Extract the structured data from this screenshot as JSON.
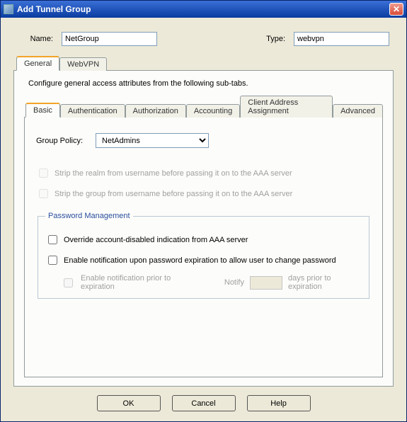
{
  "window": {
    "title": "Add Tunnel Group"
  },
  "form": {
    "name_label": "Name:",
    "name_value": "NetGroup",
    "type_label": "Type:",
    "type_value": "webvpn"
  },
  "top_tabs": {
    "general": "General",
    "webvpn": "WebVPN"
  },
  "prompt": "Configure general access attributes from the following sub-tabs.",
  "sub_tabs": {
    "basic": "Basic",
    "authentication": "Authentication",
    "authorization": "Authorization",
    "accounting": "Accounting",
    "caa": "Client Address Assignment",
    "advanced": "Advanced"
  },
  "basic": {
    "group_policy_label": "Group Policy:",
    "group_policy_value": "NetAdmins",
    "strip_realm": "Strip the realm from username before passing it on to the AAA server",
    "strip_group": "Strip the group from username before passing it on to the AAA server",
    "pwd_legend": "Password Management",
    "override_aaa": "Override account-disabled indication from AAA server",
    "enable_notify": "Enable notification upon password expiration to allow user to change password",
    "enable_prior": "Enable notification prior to expiration",
    "notify_label": "Notify",
    "days_label": "days prior to expiration"
  },
  "buttons": {
    "ok": "OK",
    "cancel": "Cancel",
    "help": "Help"
  }
}
